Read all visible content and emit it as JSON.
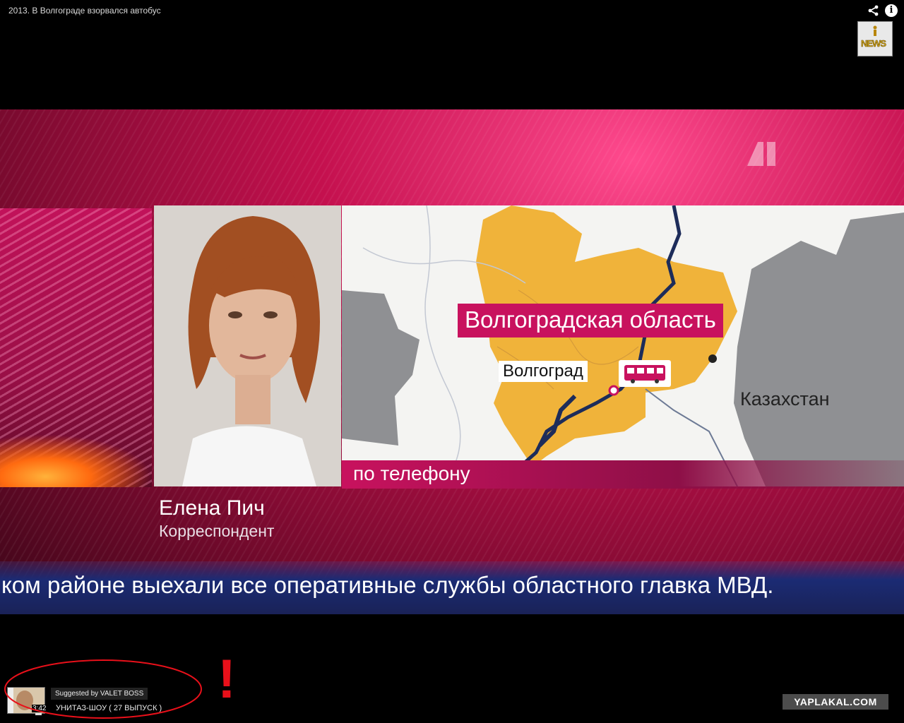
{
  "player": {
    "title": "2013. В Волгограде взорвался автобус",
    "share_icon": "share-icon",
    "info_icon": "info-icon",
    "info_glyph": "i",
    "channel_logo_text": "NEWS"
  },
  "broadcast": {
    "map": {
      "region": "Волгоградская область",
      "city": "Волгоград",
      "country": "Казахстан",
      "marker_icon": "bus-icon"
    },
    "phone_caption": "по телефону",
    "reporter_name": "Елена Пич",
    "reporter_role": "Корреспондент",
    "ticker": "ком районе выехали все оперативные службы областного главка МВД."
  },
  "suggestion": {
    "by": "Suggested by VALET BOSS",
    "title": "УНИТАЗ-ШОУ ( 27 ВЫПУСК )",
    "duration": "3:42"
  },
  "annotation": {
    "exclamation": "!"
  },
  "watermark": "YAPLAKAL.COM",
  "colors": {
    "accent": "#c8125e",
    "map_region": "#f0b33a",
    "ticker_bg": "#1b2b74",
    "annotation": "#e8101a"
  }
}
